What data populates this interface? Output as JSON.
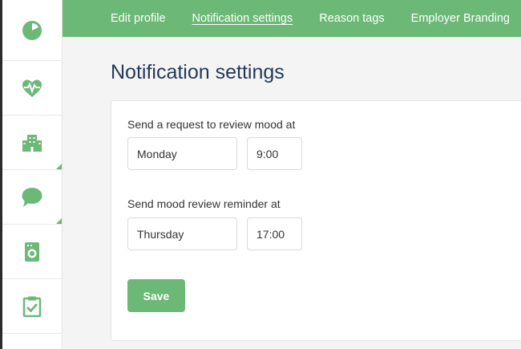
{
  "nav": {
    "items": [
      {
        "label": "Edit profile"
      },
      {
        "label": "Notification settings",
        "active": true
      },
      {
        "label": "Reason tags"
      },
      {
        "label": "Employer Branding"
      }
    ]
  },
  "sidebar": {
    "items": [
      {
        "icon": "pie-chart-icon"
      },
      {
        "icon": "heartbeat-icon"
      },
      {
        "icon": "office-building-icon"
      },
      {
        "icon": "speech-bubble-icon"
      },
      {
        "icon": "mood-device-icon"
      },
      {
        "icon": "clipboard-check-icon"
      }
    ]
  },
  "page": {
    "title": "Notification settings"
  },
  "form": {
    "request": {
      "label": "Send a request to review mood at",
      "day": "Monday",
      "time": "9:00"
    },
    "reminder": {
      "label": "Send mood review reminder at",
      "day": "Thursday",
      "time": "17:00"
    },
    "save_label": "Save"
  },
  "colors": {
    "accent": "#6cb877",
    "title": "#223a59"
  }
}
